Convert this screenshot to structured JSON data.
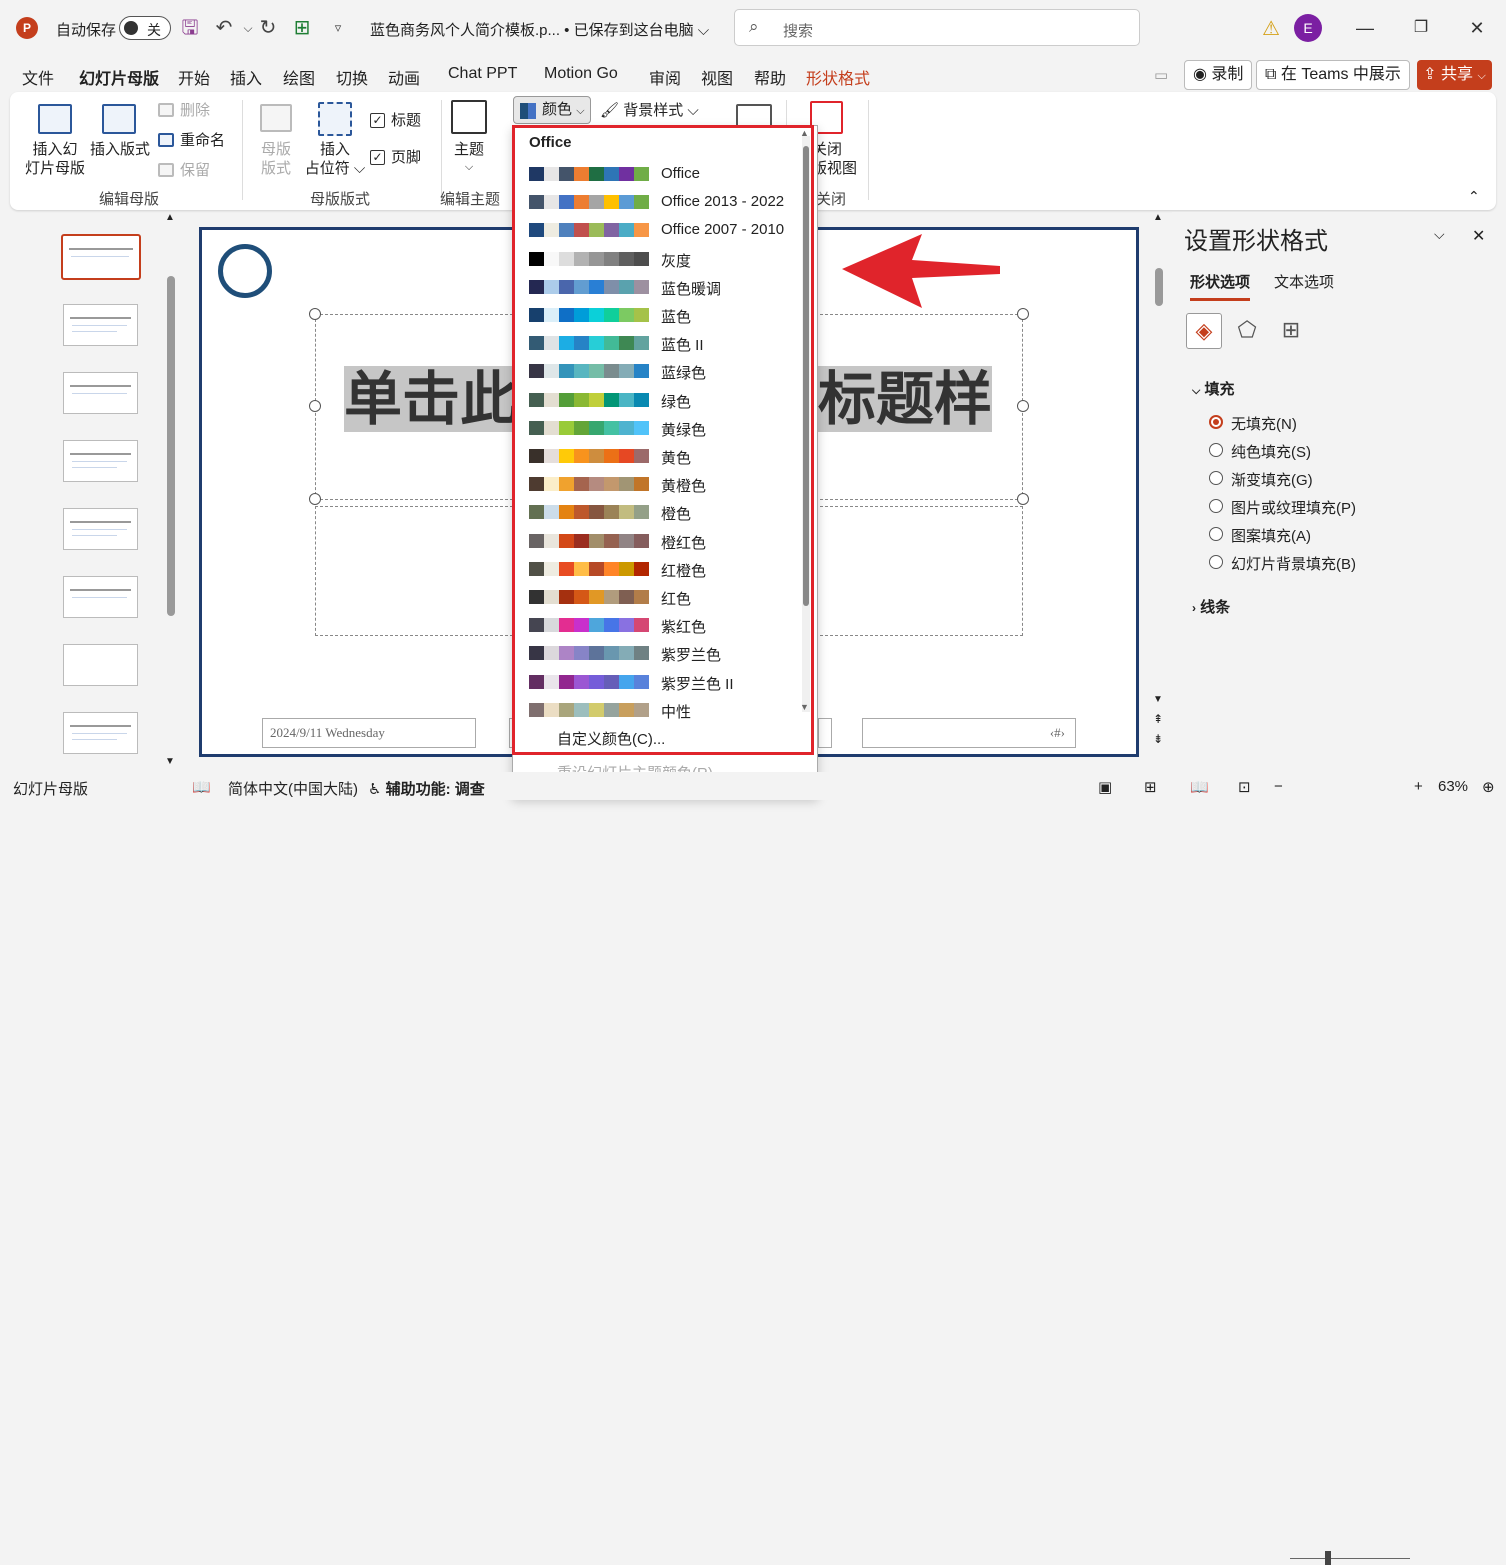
{
  "titlebar": {
    "app_icon": "P",
    "autosave_label": "自动保存",
    "autosave_state": "关",
    "doc_title": "蓝色商务风个人简介模板.p...  • 已保存到这台电脑 ⌵",
    "search_placeholder": "搜索",
    "avatar_initial": "E",
    "icons": [
      "save-icon",
      "undo-icon",
      "redo-icon",
      "present-icon",
      "customize-icon",
      "warning-icon",
      "minimize-icon",
      "restore-icon",
      "close-icon"
    ]
  },
  "menu": {
    "tabs": [
      "文件",
      "幻灯片母版",
      "开始",
      "插入",
      "绘图",
      "切换",
      "动画",
      "Chat PPT",
      "Motion Go",
      "审阅",
      "视图",
      "帮助",
      "形状格式"
    ],
    "active_tab": "幻灯片母版",
    "record_label": "录制",
    "teams_label": "在 Teams 中展示",
    "share_label": "共享"
  },
  "ribbon": {
    "insert_master": "插入幻\n灯片母版",
    "insert_layout": "插入版式",
    "delete": "删除",
    "rename": "重命名",
    "preserve": "保留",
    "group_edit_master": "编辑母版",
    "master_layout": "母版\n版式",
    "insert_placeholder": "插入\n占位符 ⌵",
    "title_check": "标题",
    "footer_check": "页脚",
    "group_master_layout": "母版版式",
    "theme": "主题",
    "group_edit_theme": "编辑主题",
    "colors_label": "颜色",
    "bg_style_label": "背景样式 ⌵",
    "close_view": "关闭\n版视图",
    "group_close": "关闭"
  },
  "dropdown": {
    "header": "Office",
    "items": [
      {
        "name": "Office",
        "colors": [
          "#1f3864",
          "#e7e6e6",
          "#44546a",
          "#ed7d31",
          "#1f6e43",
          "#2e75b6",
          "#7030a0",
          "#70ad47"
        ]
      },
      {
        "name": "Office 2013 - 2022",
        "colors": [
          "#44546a",
          "#e7e6e6",
          "#4472c4",
          "#ed7d31",
          "#a5a5a5",
          "#ffc000",
          "#5b9bd5",
          "#70ad47"
        ]
      },
      {
        "name": "Office 2007 - 2010",
        "colors": [
          "#1f497d",
          "#eeece1",
          "#4f81bd",
          "#c0504d",
          "#9bbb59",
          "#8064a2",
          "#4bacc6",
          "#f79646"
        ]
      },
      {
        "name": "灰度",
        "colors": [
          "#000000",
          "#f8f8f8",
          "#dddddd",
          "#b2b2b2",
          "#969696",
          "#808080",
          "#5f5f5f",
          "#4d4d4d"
        ]
      },
      {
        "name": "蓝色暖调",
        "colors": [
          "#242852",
          "#acccea",
          "#4a66ac",
          "#629dd1",
          "#297fd5",
          "#7f8fa9",
          "#5aa2ae",
          "#9d90a0"
        ]
      },
      {
        "name": "蓝色",
        "colors": [
          "#17406d",
          "#dbeff9",
          "#0f6fc6",
          "#009dd9",
          "#0bd0d9",
          "#10cf9b",
          "#7cca62",
          "#a5c249"
        ]
      },
      {
        "name": "蓝色 II",
        "colors": [
          "#335b74",
          "#dfe3e5",
          "#1cade4",
          "#2683c6",
          "#27ced7",
          "#42ba97",
          "#3e8853",
          "#62a39f"
        ]
      },
      {
        "name": "蓝绿色",
        "colors": [
          "#373545",
          "#dee6e8",
          "#3494ba",
          "#58b6c0",
          "#75bda7",
          "#7a8c8e",
          "#84acb6",
          "#2683c6"
        ]
      },
      {
        "name": "绿色",
        "colors": [
          "#455f51",
          "#e3ded1",
          "#549e39",
          "#8ab833",
          "#c0cf3a",
          "#029676",
          "#4ab5c4",
          "#0989b1"
        ]
      },
      {
        "name": "黄绿色",
        "colors": [
          "#455f51",
          "#e3ded1",
          "#99cb38",
          "#63a537",
          "#37a76f",
          "#44c1a3",
          "#4eb3cf",
          "#51c3f9"
        ]
      },
      {
        "name": "黄色",
        "colors": [
          "#39302a",
          "#e5dedb",
          "#ffca08",
          "#f8931d",
          "#ce8d3e",
          "#ec7016",
          "#e64823",
          "#9c6a6a"
        ]
      },
      {
        "name": "黄橙色",
        "colors": [
          "#4e3b30",
          "#fbeec9",
          "#f0a22e",
          "#a5644e",
          "#b58b80",
          "#c3986d",
          "#a19574",
          "#c17529"
        ]
      },
      {
        "name": "橙色",
        "colors": [
          "#637052",
          "#ccddea",
          "#e48312",
          "#bd582c",
          "#865640",
          "#9b8357",
          "#c2bc80",
          "#94a088"
        ]
      },
      {
        "name": "橙红色",
        "colors": [
          "#696464",
          "#e9e5dc",
          "#d34817",
          "#9b2d1f",
          "#a28e6a",
          "#956251",
          "#918485",
          "#855d5d"
        ]
      },
      {
        "name": "红橙色",
        "colors": [
          "#505046",
          "#eeece1",
          "#e84c22",
          "#ffbd47",
          "#b64926",
          "#ff8427",
          "#cc9900",
          "#b22600"
        ]
      },
      {
        "name": "红色",
        "colors": [
          "#323232",
          "#e3ded1",
          "#a5300f",
          "#d55816",
          "#e19825",
          "#b19c7d",
          "#7f5f52",
          "#b27d49"
        ]
      },
      {
        "name": "紫红色",
        "colors": [
          "#454551",
          "#d8d9dc",
          "#e32d91",
          "#c830cc",
          "#4ea6dc",
          "#4775e7",
          "#8971e1",
          "#d54773"
        ]
      },
      {
        "name": "紫罗兰色",
        "colors": [
          "#373545",
          "#dcd8dc",
          "#ad84c6",
          "#8784c7",
          "#5d739a",
          "#6997af",
          "#84acb6",
          "#6f8183"
        ]
      },
      {
        "name": "紫罗兰色 II",
        "colors": [
          "#632e62",
          "#eae5eb",
          "#92278f",
          "#9b57d3",
          "#755dd9",
          "#665eb8",
          "#45a5ed",
          "#5982db"
        ]
      },
      {
        "name": "中性",
        "colors": [
          "#7f6f6f",
          "#ebddc3",
          "#a9a57c",
          "#9cbebd",
          "#d2cb6c",
          "#95a39d",
          "#c89f5d",
          "#b1a089"
        ]
      }
    ],
    "custom_colors": "自定义颜色(C)...",
    "reset_colors": "重设幻灯片主题颜色(R)"
  },
  "slide": {
    "title_left": "单击此",
    "title_right": "标题样",
    "date_footer": "2024/9/11 Wednesday",
    "page_footer": "‹#›",
    "accent_color": "#1f3c6e"
  },
  "format_pane": {
    "title": "设置形状格式",
    "tab_shape": "形状选项",
    "tab_text": "文本选项",
    "fill_section": "填充",
    "fill_options": [
      "无填充(N)",
      "纯色填充(S)",
      "渐变填充(G)",
      "图片或纹理填充(P)",
      "图案填充(A)",
      "幻灯片背景填充(B)"
    ],
    "selected_fill": "无填充(N)",
    "line_section": "线条"
  },
  "statusbar": {
    "view_label": "幻灯片母版",
    "language": "简体中文(中国大陆)",
    "accessibility": "辅助功能: 调查",
    "zoom": "63%"
  }
}
